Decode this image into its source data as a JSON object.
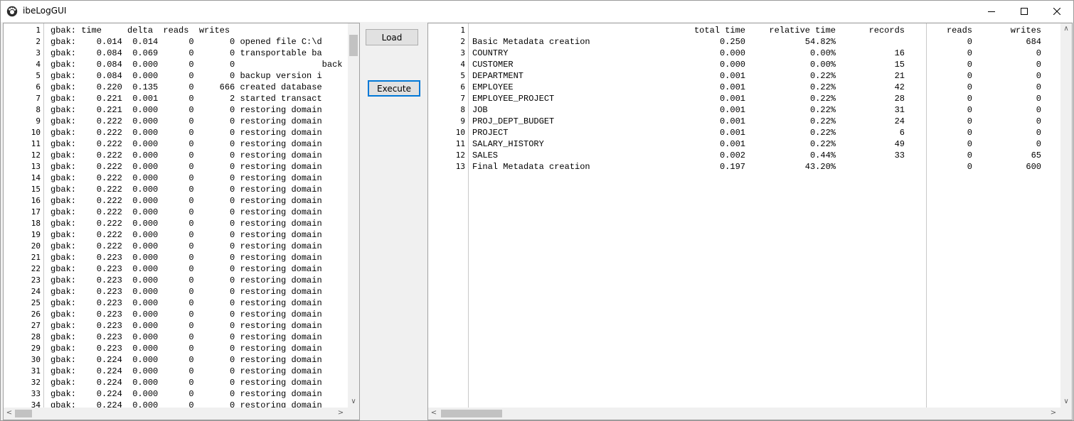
{
  "window": {
    "title": "ibeLogGUI"
  },
  "buttons": {
    "load": "Load",
    "execute": "Execute"
  },
  "left_panel": {
    "lines": [
      {
        "n": "1",
        "text": "gbak: time     delta  reads  writes"
      },
      {
        "n": "2",
        "text": "gbak:    0.014  0.014      0       0 opened file C:\\d"
      },
      {
        "n": "3",
        "text": "gbak:    0.084  0.069      0       0 transportable ba"
      },
      {
        "n": "4",
        "text": "gbak:    0.084  0.000      0       0                 back"
      },
      {
        "n": "5",
        "text": "gbak:    0.084  0.000      0       0 backup version i"
      },
      {
        "n": "6",
        "text": "gbak:    0.220  0.135      0     666 created database"
      },
      {
        "n": "7",
        "text": "gbak:    0.221  0.001      0       2 started transact"
      },
      {
        "n": "8",
        "text": "gbak:    0.221  0.000      0       0 restoring domain"
      },
      {
        "n": "9",
        "text": "gbak:    0.222  0.000      0       0 restoring domain"
      },
      {
        "n": "10",
        "text": "gbak:    0.222  0.000      0       0 restoring domain"
      },
      {
        "n": "11",
        "text": "gbak:    0.222  0.000      0       0 restoring domain"
      },
      {
        "n": "12",
        "text": "gbak:    0.222  0.000      0       0 restoring domain"
      },
      {
        "n": "13",
        "text": "gbak:    0.222  0.000      0       0 restoring domain"
      },
      {
        "n": "14",
        "text": "gbak:    0.222  0.000      0       0 restoring domain"
      },
      {
        "n": "15",
        "text": "gbak:    0.222  0.000      0       0 restoring domain"
      },
      {
        "n": "16",
        "text": "gbak:    0.222  0.000      0       0 restoring domain"
      },
      {
        "n": "17",
        "text": "gbak:    0.222  0.000      0       0 restoring domain"
      },
      {
        "n": "18",
        "text": "gbak:    0.222  0.000      0       0 restoring domain"
      },
      {
        "n": "19",
        "text": "gbak:    0.222  0.000      0       0 restoring domain"
      },
      {
        "n": "20",
        "text": "gbak:    0.222  0.000      0       0 restoring domain"
      },
      {
        "n": "21",
        "text": "gbak:    0.223  0.000      0       0 restoring domain"
      },
      {
        "n": "22",
        "text": "gbak:    0.223  0.000      0       0 restoring domain"
      },
      {
        "n": "23",
        "text": "gbak:    0.223  0.000      0       0 restoring domain"
      },
      {
        "n": "24",
        "text": "gbak:    0.223  0.000      0       0 restoring domain"
      },
      {
        "n": "25",
        "text": "gbak:    0.223  0.000      0       0 restoring domain"
      },
      {
        "n": "26",
        "text": "gbak:    0.223  0.000      0       0 restoring domain"
      },
      {
        "n": "27",
        "text": "gbak:    0.223  0.000      0       0 restoring domain"
      },
      {
        "n": "28",
        "text": "gbak:    0.223  0.000      0       0 restoring domain"
      },
      {
        "n": "29",
        "text": "gbak:    0.223  0.000      0       0 restoring domain"
      },
      {
        "n": "30",
        "text": "gbak:    0.224  0.000      0       0 restoring domain"
      },
      {
        "n": "31",
        "text": "gbak:    0.224  0.000      0       0 restoring domain"
      },
      {
        "n": "32",
        "text": "gbak:    0.224  0.000      0       0 restoring domain"
      },
      {
        "n": "33",
        "text": "gbak:    0.224  0.000      0       0 restoring domain"
      },
      {
        "n": "34",
        "text": "gbak:    0.224  0.000      0       0 restoring domain"
      }
    ]
  },
  "right_panel": {
    "lines": [
      {
        "n": "1",
        "name": "",
        "total": "total time",
        "rel": "relative time",
        "records": "records",
        "reads": "reads",
        "writes": "writes"
      },
      {
        "n": "2",
        "name": "Basic Metadata creation",
        "total": "0.250",
        "rel": "54.82%",
        "records": "",
        "reads": "0",
        "writes": "684"
      },
      {
        "n": "3",
        "name": "COUNTRY",
        "total": "0.000",
        "rel": "0.00%",
        "records": "16",
        "reads": "0",
        "writes": "0"
      },
      {
        "n": "4",
        "name": "CUSTOMER",
        "total": "0.000",
        "rel": "0.00%",
        "records": "15",
        "reads": "0",
        "writes": "0"
      },
      {
        "n": "5",
        "name": "DEPARTMENT",
        "total": "0.001",
        "rel": "0.22%",
        "records": "21",
        "reads": "0",
        "writes": "0"
      },
      {
        "n": "6",
        "name": "EMPLOYEE",
        "total": "0.001",
        "rel": "0.22%",
        "records": "42",
        "reads": "0",
        "writes": "0"
      },
      {
        "n": "7",
        "name": "EMPLOYEE_PROJECT",
        "total": "0.001",
        "rel": "0.22%",
        "records": "28",
        "reads": "0",
        "writes": "0"
      },
      {
        "n": "8",
        "name": "JOB",
        "total": "0.001",
        "rel": "0.22%",
        "records": "31",
        "reads": "0",
        "writes": "0"
      },
      {
        "n": "9",
        "name": "PROJ_DEPT_BUDGET",
        "total": "0.001",
        "rel": "0.22%",
        "records": "24",
        "reads": "0",
        "writes": "0"
      },
      {
        "n": "10",
        "name": "PROJECT",
        "total": "0.001",
        "rel": "0.22%",
        "records": "6",
        "reads": "0",
        "writes": "0"
      },
      {
        "n": "11",
        "name": "SALARY_HISTORY",
        "total": "0.001",
        "rel": "0.22%",
        "records": "49",
        "reads": "0",
        "writes": "0"
      },
      {
        "n": "12",
        "name": "SALES",
        "total": "0.002",
        "rel": "0.44%",
        "records": "33",
        "reads": "0",
        "writes": "65"
      },
      {
        "n": "13",
        "name": "Final Metadata creation",
        "total": "0.197",
        "rel": "43.20%",
        "records": "",
        "reads": "0",
        "writes": "600"
      }
    ]
  }
}
